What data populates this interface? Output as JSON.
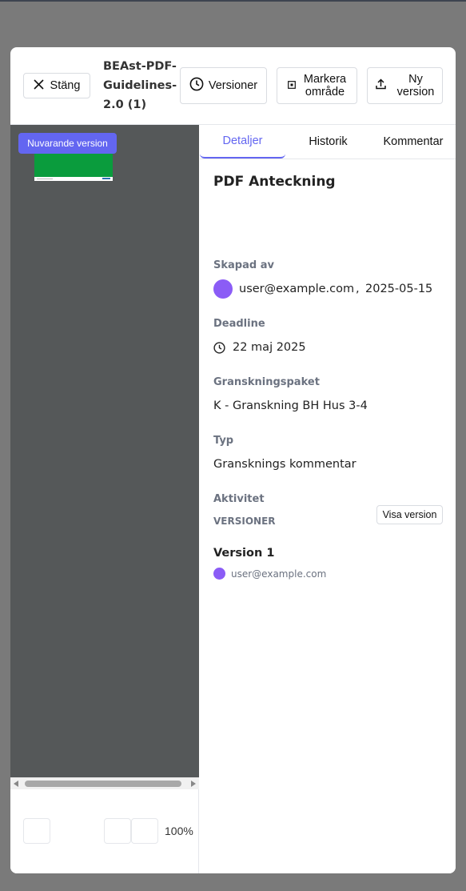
{
  "header": {
    "close_label": "Stäng",
    "doc_title": "BEAst-PDF-Guidelines-2.0 (1)",
    "versions_label": "Versioner",
    "mark_area_label": "Markera\nområde",
    "new_version_label": "Ny\nversion"
  },
  "viewer": {
    "current_version_badge": "Nuvarande version",
    "zoom": "100%"
  },
  "tabs": [
    "Detaljer",
    "Historik",
    "Kommentar"
  ],
  "details": {
    "title": "PDF Anteckning",
    "created_by_label": "Skapad av",
    "created_by_user": "user@example.com",
    "created_separator": ",",
    "created_date": "2025-05-15",
    "deadline_label": "Deadline",
    "deadline_value": "22 maj 2025",
    "package_label": "Granskningspaket",
    "package_value": "K - Granskning BH Hus 3-4",
    "type_label": "Typ",
    "type_value": "Gransknings kommentar",
    "activity_label": "Aktivitet",
    "versions_heading": "VERSIONER",
    "version_name": "Version 1",
    "version_user": "user@example.com",
    "view_version_label": "Visa version"
  },
  "colors": {
    "accent": "#6366f1",
    "avatar": "#8b5cf6",
    "viewer_bg": "#555859",
    "page_green": "#0a9c3d"
  },
  "icons": {
    "close": "close-icon",
    "versions": "clock-icon",
    "mark_area": "select-area-icon",
    "new_version": "upload-icon",
    "deadline": "clock-icon"
  }
}
